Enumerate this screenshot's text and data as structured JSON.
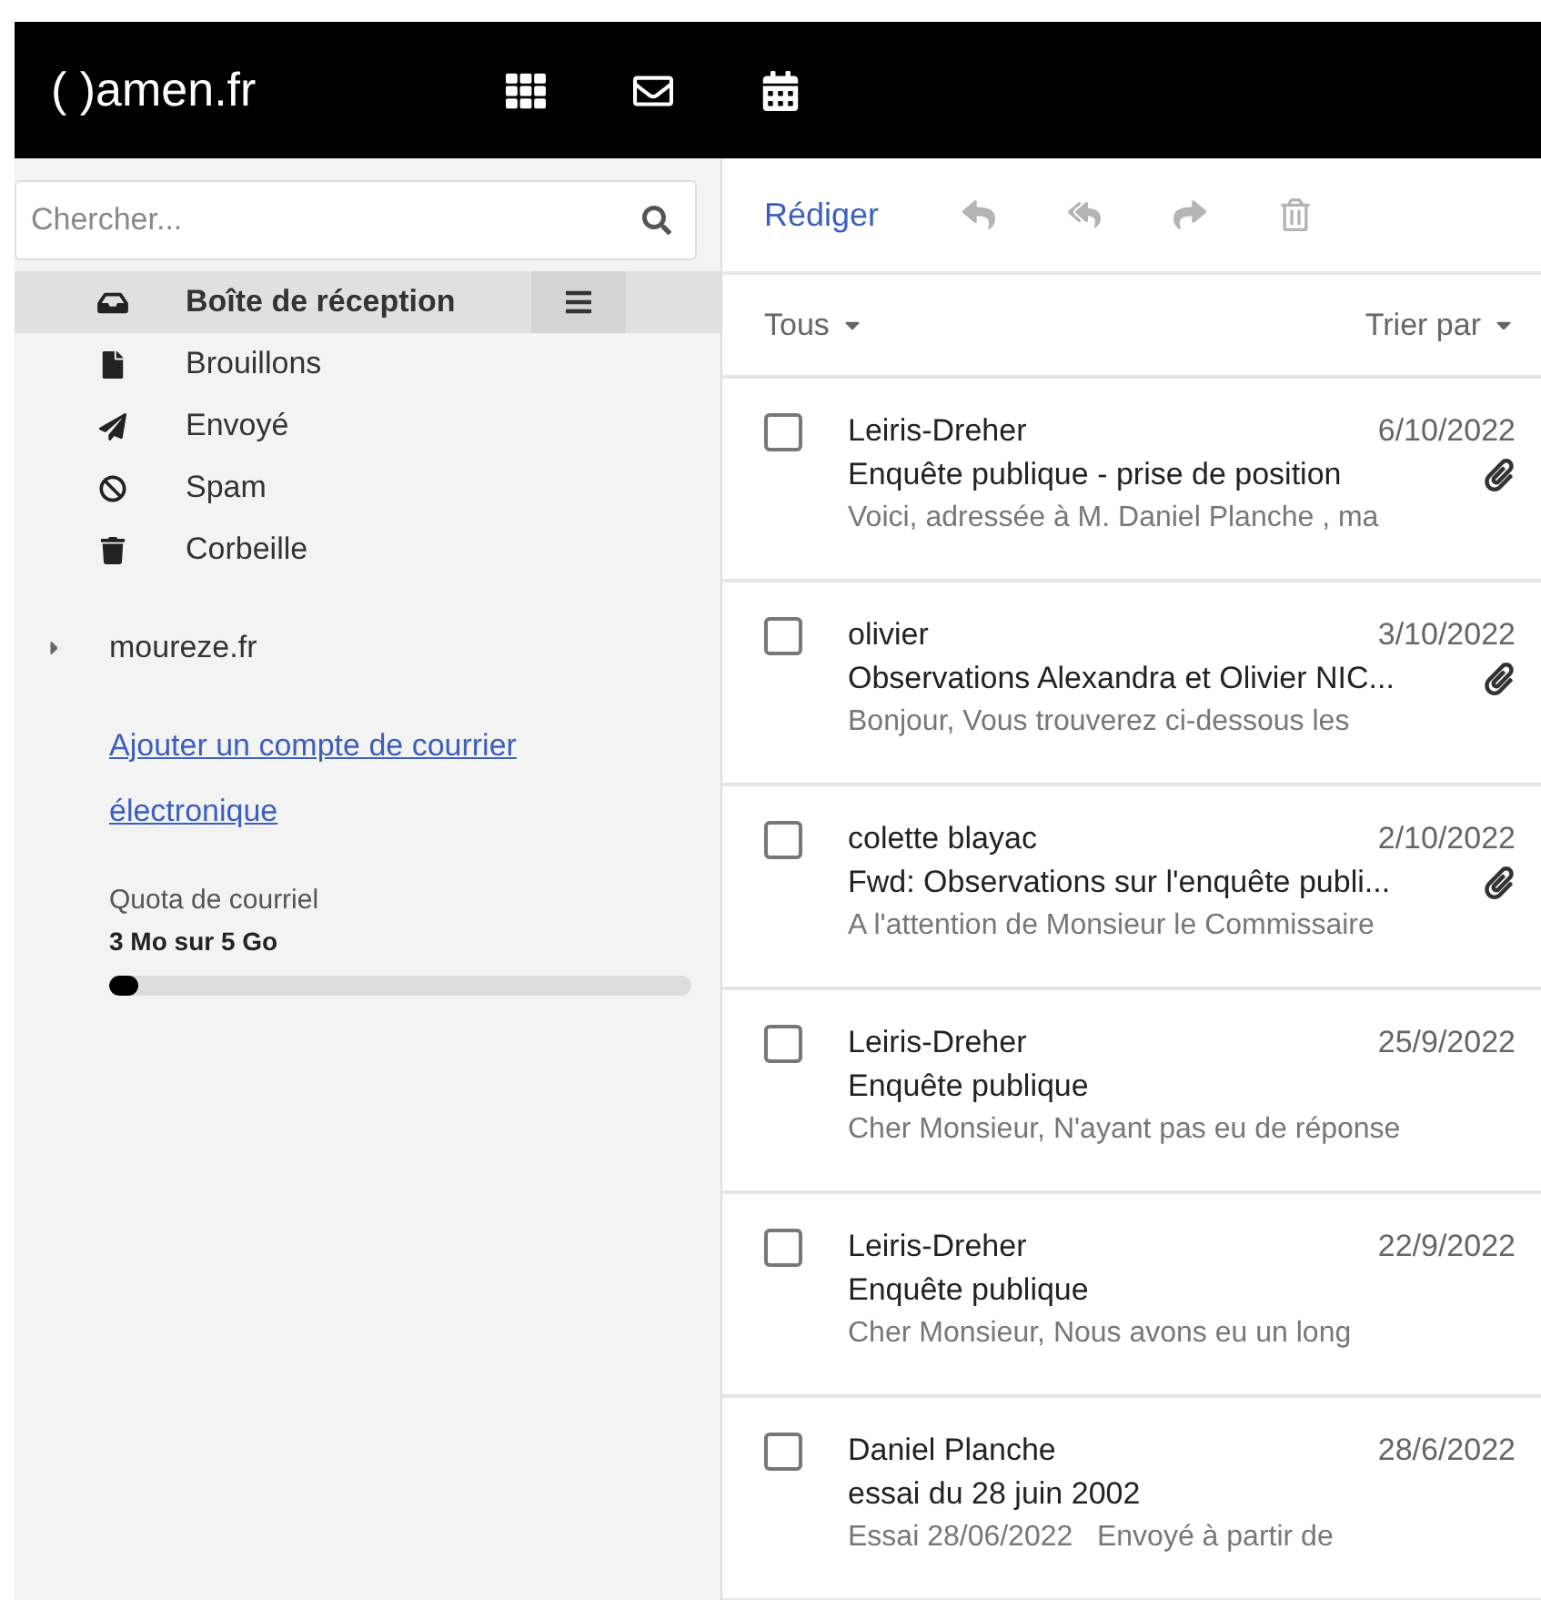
{
  "header": {
    "logo": "( )amen.fr",
    "apps": [
      {
        "kind": "apps",
        "selected": false
      },
      {
        "kind": "mail",
        "selected": false
      },
      {
        "kind": "calendar",
        "selected": false
      }
    ]
  },
  "sidebar": {
    "search": {
      "placeholder": "Chercher..."
    },
    "folders": [
      {
        "kind": "inbox",
        "label": "Boîte de réception",
        "selected": true
      },
      {
        "kind": "drafts",
        "label": "Brouillons",
        "selected": false
      },
      {
        "kind": "sent",
        "label": "Envoyé",
        "selected": false
      },
      {
        "kind": "spam",
        "label": "Spam",
        "selected": false
      },
      {
        "kind": "trash",
        "label": "Corbeille",
        "selected": false
      }
    ],
    "account": {
      "label": "moureze.fr",
      "expanded": false
    },
    "add_account_link": [
      "Ajouter un compte de courrier",
      "électronique"
    ],
    "quota": {
      "label": "Quota de courriel",
      "reading": "3 Mo sur 5 Go",
      "level": 0.05
    }
  },
  "toolbar": {
    "compose": "Rédiger",
    "actions": [
      {
        "kind": "reply",
        "disabled": true
      },
      {
        "kind": "reply_all",
        "disabled": true
      },
      {
        "kind": "forward",
        "disabled": true
      },
      {
        "kind": "delete",
        "disabled": true
      }
    ]
  },
  "filter": {
    "label": "Tous",
    "sort": "Trier par"
  },
  "messages": [
    {
      "sender": "Leiris-Dreher",
      "date": "6/10/2022",
      "subject": "Enquête publique - prise de position",
      "preview": "Voici, adressée à M. Daniel Planche , ma",
      "attachment": true,
      "checked": false
    },
    {
      "sender": "olivier",
      "date": "3/10/2022",
      "subject": "Observations Alexandra et Olivier NIC...",
      "preview": "Bonjour, Vous trouverez ci-dessous les",
      "attachment": true,
      "checked": false
    },
    {
      "sender": "colette blayac",
      "date": "2/10/2022",
      "subject": "Fwd: Observations sur l'enquête publi...",
      "preview": "A l'attention de Monsieur le Commissaire",
      "attachment": true,
      "checked": false
    },
    {
      "sender": "Leiris-Dreher",
      "date": "25/9/2022",
      "subject": "Enquête publique",
      "preview": "Cher Monsieur, N'ayant pas eu de réponse",
      "attachment": false,
      "checked": false
    },
    {
      "sender": "Leiris-Dreher",
      "date": "22/9/2022",
      "subject": "Enquête publique",
      "preview": "Cher Monsieur, Nous avons eu un long",
      "attachment": false,
      "checked": false
    },
    {
      "sender": "Daniel Planche",
      "date": "28/6/2022",
      "subject": "essai du 28 juin 2002",
      "preview": "Essai 28/06/2022   Envoyé à partir de",
      "attachment": false,
      "checked": false
    }
  ]
}
